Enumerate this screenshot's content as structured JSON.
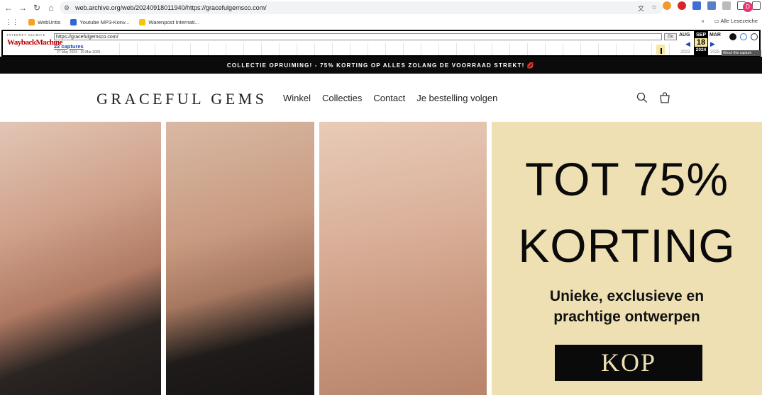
{
  "browser": {
    "url": "web.archive.org/web/20240918011940/https://gracefulgemsco.com/",
    "bookmarks": [
      "WebUntis",
      "Youtube MP3-Konv...",
      "Warenpost Internati..."
    ],
    "bookmarks_more": "»",
    "all_bookmarks": "Alle Lesezeiche",
    "profile_initial": "D"
  },
  "wayback": {
    "logo_top": "INTERNET ARCHIVE",
    "logo_main": "WaybackMachine",
    "url_field": "https://gracefulgemsco.com/",
    "go_label": "Go",
    "captures": "22 captures",
    "range": "27 May 2024 - 10 Mar 2025",
    "prev_month": "AUG",
    "cur_month": "SEP",
    "next_month": "MAR",
    "day": "18",
    "prev_year": "2023",
    "cur_year": "2024",
    "next_year": "2025",
    "about": "About this capture"
  },
  "promo_bar": {
    "text": "COLLECTIE OPRUIMING! - 75% KORTING OP ALLES ZOLANG DE VOORRAAD STREKT! 💋"
  },
  "header": {
    "logo": "GRACEFUL GEMS",
    "nav": [
      "Winkel",
      "Collecties",
      "Contact",
      "Je bestelling volgen"
    ]
  },
  "hero": {
    "headline_1": "TOT 75%",
    "headline_2": "KORTING",
    "subline_1": "Unieke, exclusieve en",
    "subline_2": "prachtige ontwerpen",
    "button": "KOP",
    "panel_color": "#efe0b3"
  }
}
